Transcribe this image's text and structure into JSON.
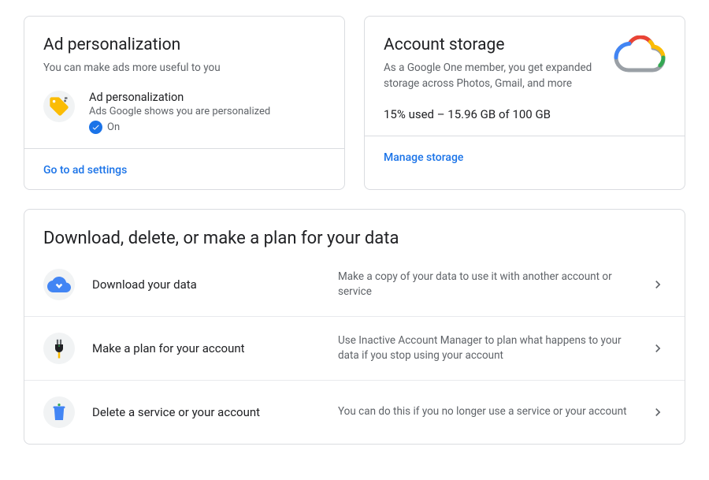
{
  "ad": {
    "title": "Ad personalization",
    "subtitle": "You can make ads more useful to you",
    "item_label": "Ad personalization",
    "item_desc": "Ads Google shows you are personalized",
    "state": "On",
    "footer_link": "Go to ad settings"
  },
  "storage": {
    "title": "Account storage",
    "subtitle": "As a Google One member, you get expanded storage across Photos, Gmail, and more",
    "usage_text": "15% used – 15.96 GB of 100 GB",
    "footer_link": "Manage storage"
  },
  "data_section": {
    "title": "Download, delete, or make a plan for your data",
    "rows": [
      {
        "label": "Download your data",
        "desc": "Make a copy of your data to use it with another account or service"
      },
      {
        "label": "Make a plan for your account",
        "desc": "Use Inactive Account Manager to plan what happens to your data if you stop using your account"
      },
      {
        "label": "Delete a service or your account",
        "desc": "You can do this if you no longer use a service or your account"
      }
    ]
  }
}
